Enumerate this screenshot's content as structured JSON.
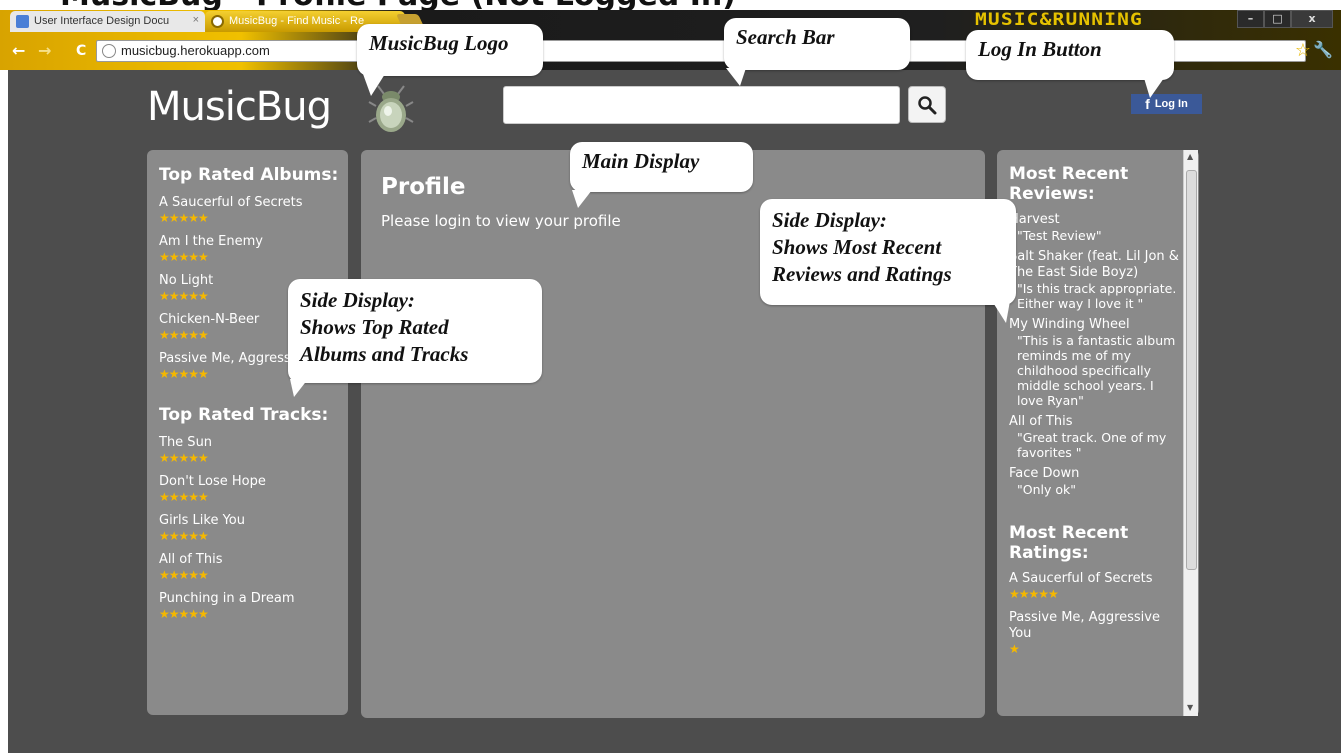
{
  "top_heading": "MusicBug - Profile Page (Not Logged In)",
  "browser": {
    "tabs": [
      {
        "label": "User Interface Design Docu",
        "active": false
      },
      {
        "label": "MusicBug - Find Music - Re",
        "active": true
      }
    ],
    "skin_text": "MUSIC&RUNNING",
    "url": "musicbug.herokuapp.com",
    "window_buttons": [
      "–",
      "□",
      "x"
    ]
  },
  "site": {
    "logo_text": "MusicBug",
    "search_placeholder": "",
    "login_label": "Log In"
  },
  "left_panel": {
    "albums_heading": "Top Rated Albums:",
    "albums": [
      {
        "title": "A Saucerful of Secrets",
        "stars": 5
      },
      {
        "title": "Am I the Enemy",
        "stars": 5
      },
      {
        "title": "No Light",
        "stars": 5
      },
      {
        "title": "Chicken-N-Beer",
        "stars": 5
      },
      {
        "title": "Passive Me, Aggressive You",
        "stars": 5
      }
    ],
    "tracks_heading": "Top Rated Tracks:",
    "tracks": [
      {
        "title": "The Sun",
        "stars": 5
      },
      {
        "title": "Don't Lose Hope",
        "stars": 5
      },
      {
        "title": "Girls Like You",
        "stars": 5
      },
      {
        "title": "All of This",
        "stars": 5
      },
      {
        "title": "Punching in a Dream",
        "stars": 5
      }
    ]
  },
  "main_panel": {
    "title": "Profile",
    "message": "Please login to view your profile"
  },
  "right_panel": {
    "reviews_heading": "Most Recent Reviews:",
    "reviews": [
      {
        "title": "Harvest",
        "quote": "\"Test Review\""
      },
      {
        "title": "Salt Shaker (feat. Lil Jon & The East Side Boyz)",
        "quote": "\"Is this track appropriate. Either way I love it \""
      },
      {
        "title": "My Winding Wheel",
        "quote": "\"This is a fantastic album reminds me of my childhood specifically middle school years. I love Ryan\""
      },
      {
        "title": "All of This",
        "quote": "\"Great track. One of my favorites \""
      },
      {
        "title": "Face Down",
        "quote": "\"Only ok\""
      }
    ],
    "ratings_heading": "Most Recent Ratings:",
    "ratings": [
      {
        "title": "A Saucerful of Secrets",
        "stars": 5
      },
      {
        "title": "Passive Me, Aggressive You",
        "stars": 1
      }
    ]
  },
  "callouts": {
    "logo": "MusicBug Logo",
    "search": "Search Bar",
    "login": "Log In Button",
    "main": "Main Display",
    "side_right_lines": [
      "Side Display:",
      "Shows Most Recent",
      "Reviews and Ratings"
    ],
    "side_left_lines": [
      "Side Display:",
      "Shows Top Rated",
      "Albums and Tracks"
    ]
  },
  "colors": {
    "page_bg": "#4d4d4d",
    "panel_bg": "#8a8a8a",
    "star": "#f5b800",
    "facebook": "#3b5998"
  }
}
